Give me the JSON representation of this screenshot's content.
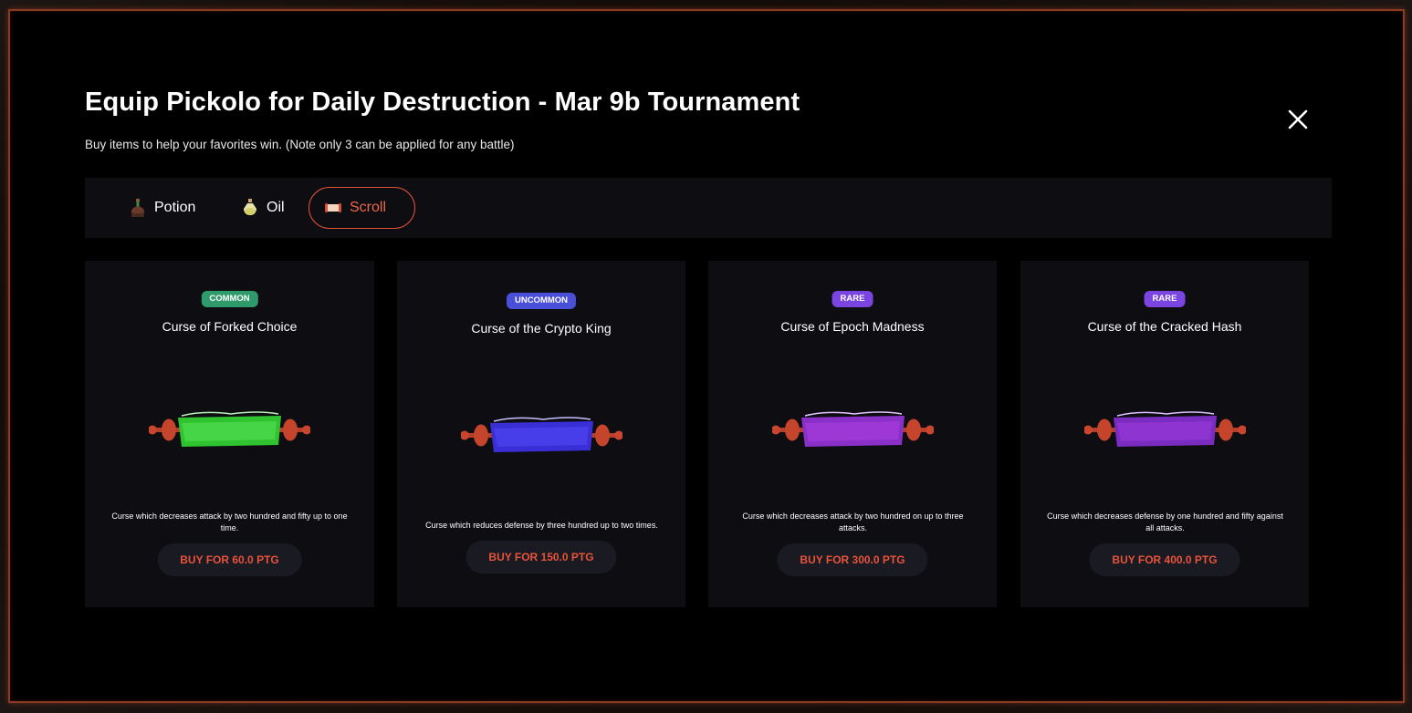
{
  "modal": {
    "title": "Equip Pickolo for Daily Destruction - Mar 9b Tournament",
    "subtitle": "Buy items to help your favorites win. (Note only 3 can be applied for any battle)",
    "close_icon": "close-icon"
  },
  "tabs": [
    {
      "label": "Potion",
      "icon": "potion-icon",
      "active": false
    },
    {
      "label": "Oil",
      "icon": "oil-icon",
      "active": false
    },
    {
      "label": "Scroll",
      "icon": "scroll-icon",
      "active": true
    }
  ],
  "colors": {
    "accent": "#e8533a",
    "common": "#2f9a6a",
    "uncommon": "#4a4fd9",
    "rare": "#7a45e0",
    "card_bg": "#0d0d12"
  },
  "items": [
    {
      "rarity": "COMMON",
      "name": "Curse of Forked Choice",
      "description": "Curse which decreases attack by two hundred and fifty up to one time.",
      "buy_label": "BUY FOR 60.0 PTG",
      "scroll_color": "green"
    },
    {
      "rarity": "UNCOMMON",
      "name": "Curse of the Crypto King",
      "description": "Curse which reduces defense by three hundred up to two times.",
      "buy_label": "BUY FOR 150.0 PTG",
      "scroll_color": "blue"
    },
    {
      "rarity": "RARE",
      "name": "Curse of Epoch Madness",
      "description": "Curse which decreases attack by two hundred on up to three attacks.",
      "buy_label": "BUY FOR 300.0 PTG",
      "scroll_color": "purple"
    },
    {
      "rarity": "RARE",
      "name": "Curse of the Cracked Hash",
      "description": "Curse which decreases defense by one hundred and fifty against all attacks.",
      "buy_label": "BUY FOR 400.0 PTG",
      "scroll_color": "purple"
    }
  ]
}
